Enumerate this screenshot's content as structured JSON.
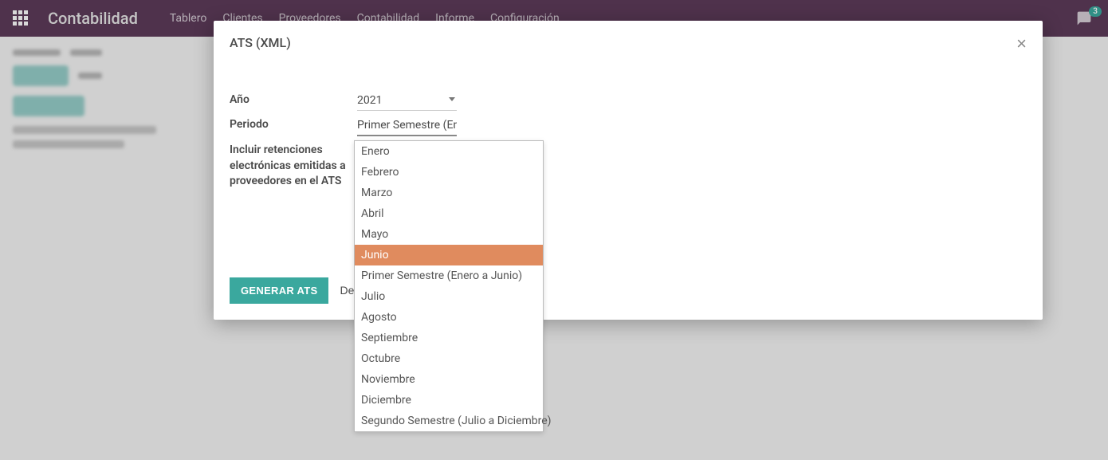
{
  "topbar": {
    "brand": "Contabilidad",
    "nav": [
      "Tablero",
      "Clientes",
      "Proveedores",
      "Contabilidad",
      "Informe",
      "Configuración"
    ],
    "message_count": "3"
  },
  "modal": {
    "title": "ATS (XML)",
    "labels": {
      "year": "Año",
      "period": "Periodo",
      "include": "Incluir retenciones electrónicas emitidas a proveedores en el ATS"
    },
    "values": {
      "year": "2021",
      "period": "Primer Semestre (Enero a Junio)"
    },
    "buttons": {
      "generate": "GENERAR ATS",
      "discard": "Descartar"
    }
  },
  "dropdown": {
    "items": [
      "Enero",
      "Febrero",
      "Marzo",
      "Abril",
      "Mayo",
      "Junio",
      "Primer Semestre (Enero a Junio)",
      "Julio",
      "Agosto",
      "Septiembre",
      "Octubre",
      "Noviembre",
      "Diciembre",
      "Segundo Semestre (Julio a Diciembre)"
    ],
    "highlighted_index": 5
  }
}
